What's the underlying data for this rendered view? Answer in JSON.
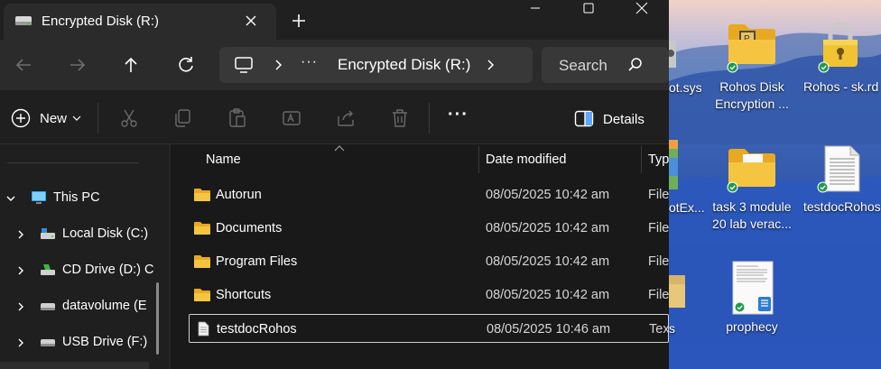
{
  "window": {
    "tab_title": "Encrypted Disk (R:)",
    "address": {
      "overflow": "···",
      "current": "Encrypted Disk (R:)"
    },
    "search_placeholder": "Search"
  },
  "toolbar": {
    "new_label": "New",
    "more_label": "···",
    "details_label": "Details"
  },
  "nav": {
    "items": [
      {
        "label": "This PC"
      },
      {
        "label": "Local Disk (C:)"
      },
      {
        "label": "CD Drive (D:) C"
      },
      {
        "label": "datavolume (E"
      },
      {
        "label": "USB Drive (F:)"
      }
    ]
  },
  "list": {
    "columns": [
      "Name",
      "Date modified",
      "Typ"
    ],
    "rows": [
      {
        "name": "Autorun",
        "date": "08/05/2025 10:42 am",
        "type": "File",
        "kind": "folder"
      },
      {
        "name": "Documents",
        "date": "08/05/2025 10:42 am",
        "type": "File",
        "kind": "folder"
      },
      {
        "name": "Program Files",
        "date": "08/05/2025 10:42 am",
        "type": "File",
        "kind": "folder"
      },
      {
        "name": "Shortcuts",
        "date": "08/05/2025 10:42 am",
        "type": "File",
        "kind": "folder"
      },
      {
        "name": "testdocRohos",
        "date": "08/05/2025 10:46 am",
        "type": "Tex",
        "kind": "text"
      }
    ]
  },
  "desktop": {
    "partials": [
      "ot.sys",
      "otEx...",
      "s"
    ],
    "icons": [
      {
        "line1": "Rohos Disk",
        "line2": "Encryption ..."
      },
      {
        "line1": "Rohos - sk.rd",
        "line2": ""
      },
      {
        "line1": "task 3 module",
        "line2": "20 lab verac..."
      },
      {
        "line1": "testdocRohos",
        "line2": ""
      },
      {
        "line1": "prophecy",
        "line2": ""
      }
    ]
  },
  "colors": {
    "window_bg": "#191919",
    "toolbar_bg": "#1f1f1f",
    "titlebar_bg": "#202020",
    "folder_yellow": "#f5c542",
    "sync_green": "#1e9a46"
  }
}
